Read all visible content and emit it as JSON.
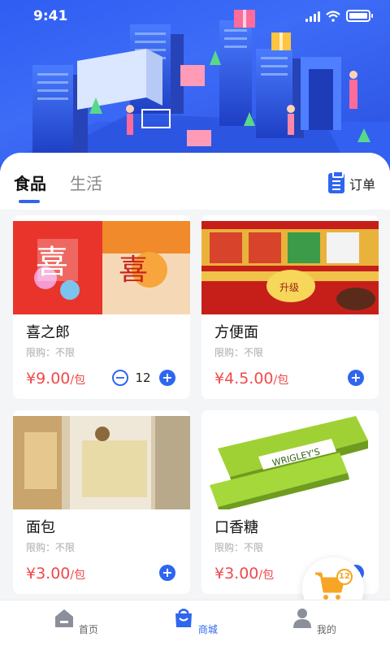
{
  "status_bar": {
    "time": "9:41"
  },
  "tabs": {
    "active": "食品",
    "other": "生活"
  },
  "orders_label": "订单",
  "products": [
    {
      "name": "喜之郎",
      "limit": "限购：不限",
      "price": "¥9.00",
      "unit": "/包",
      "quantity": "12",
      "image": "jelly-snack-photo"
    },
    {
      "name": "方便面",
      "limit": "限购：不限",
      "price": "¥4.5.00",
      "unit": "/包",
      "image": "instant-noodles-photo"
    },
    {
      "name": "面包",
      "limit": "限购：不限",
      "price": "¥3.00",
      "unit": "/包",
      "image": "bread-photo"
    },
    {
      "name": "口香糖",
      "limit": "限购：不限",
      "price": "¥3.00",
      "unit": "/包",
      "image": "chewing-gum-photo"
    }
  ],
  "cart": {
    "count": "12"
  },
  "bottom_nav": [
    {
      "label": "首页",
      "icon": "home-icon"
    },
    {
      "label": "商城",
      "icon": "shop-bag-icon"
    },
    {
      "label": "我的",
      "icon": "user-icon"
    }
  ],
  "colors": {
    "accent": "#2f66f0",
    "price": "#f04a4a",
    "cart": "#f6a624"
  }
}
